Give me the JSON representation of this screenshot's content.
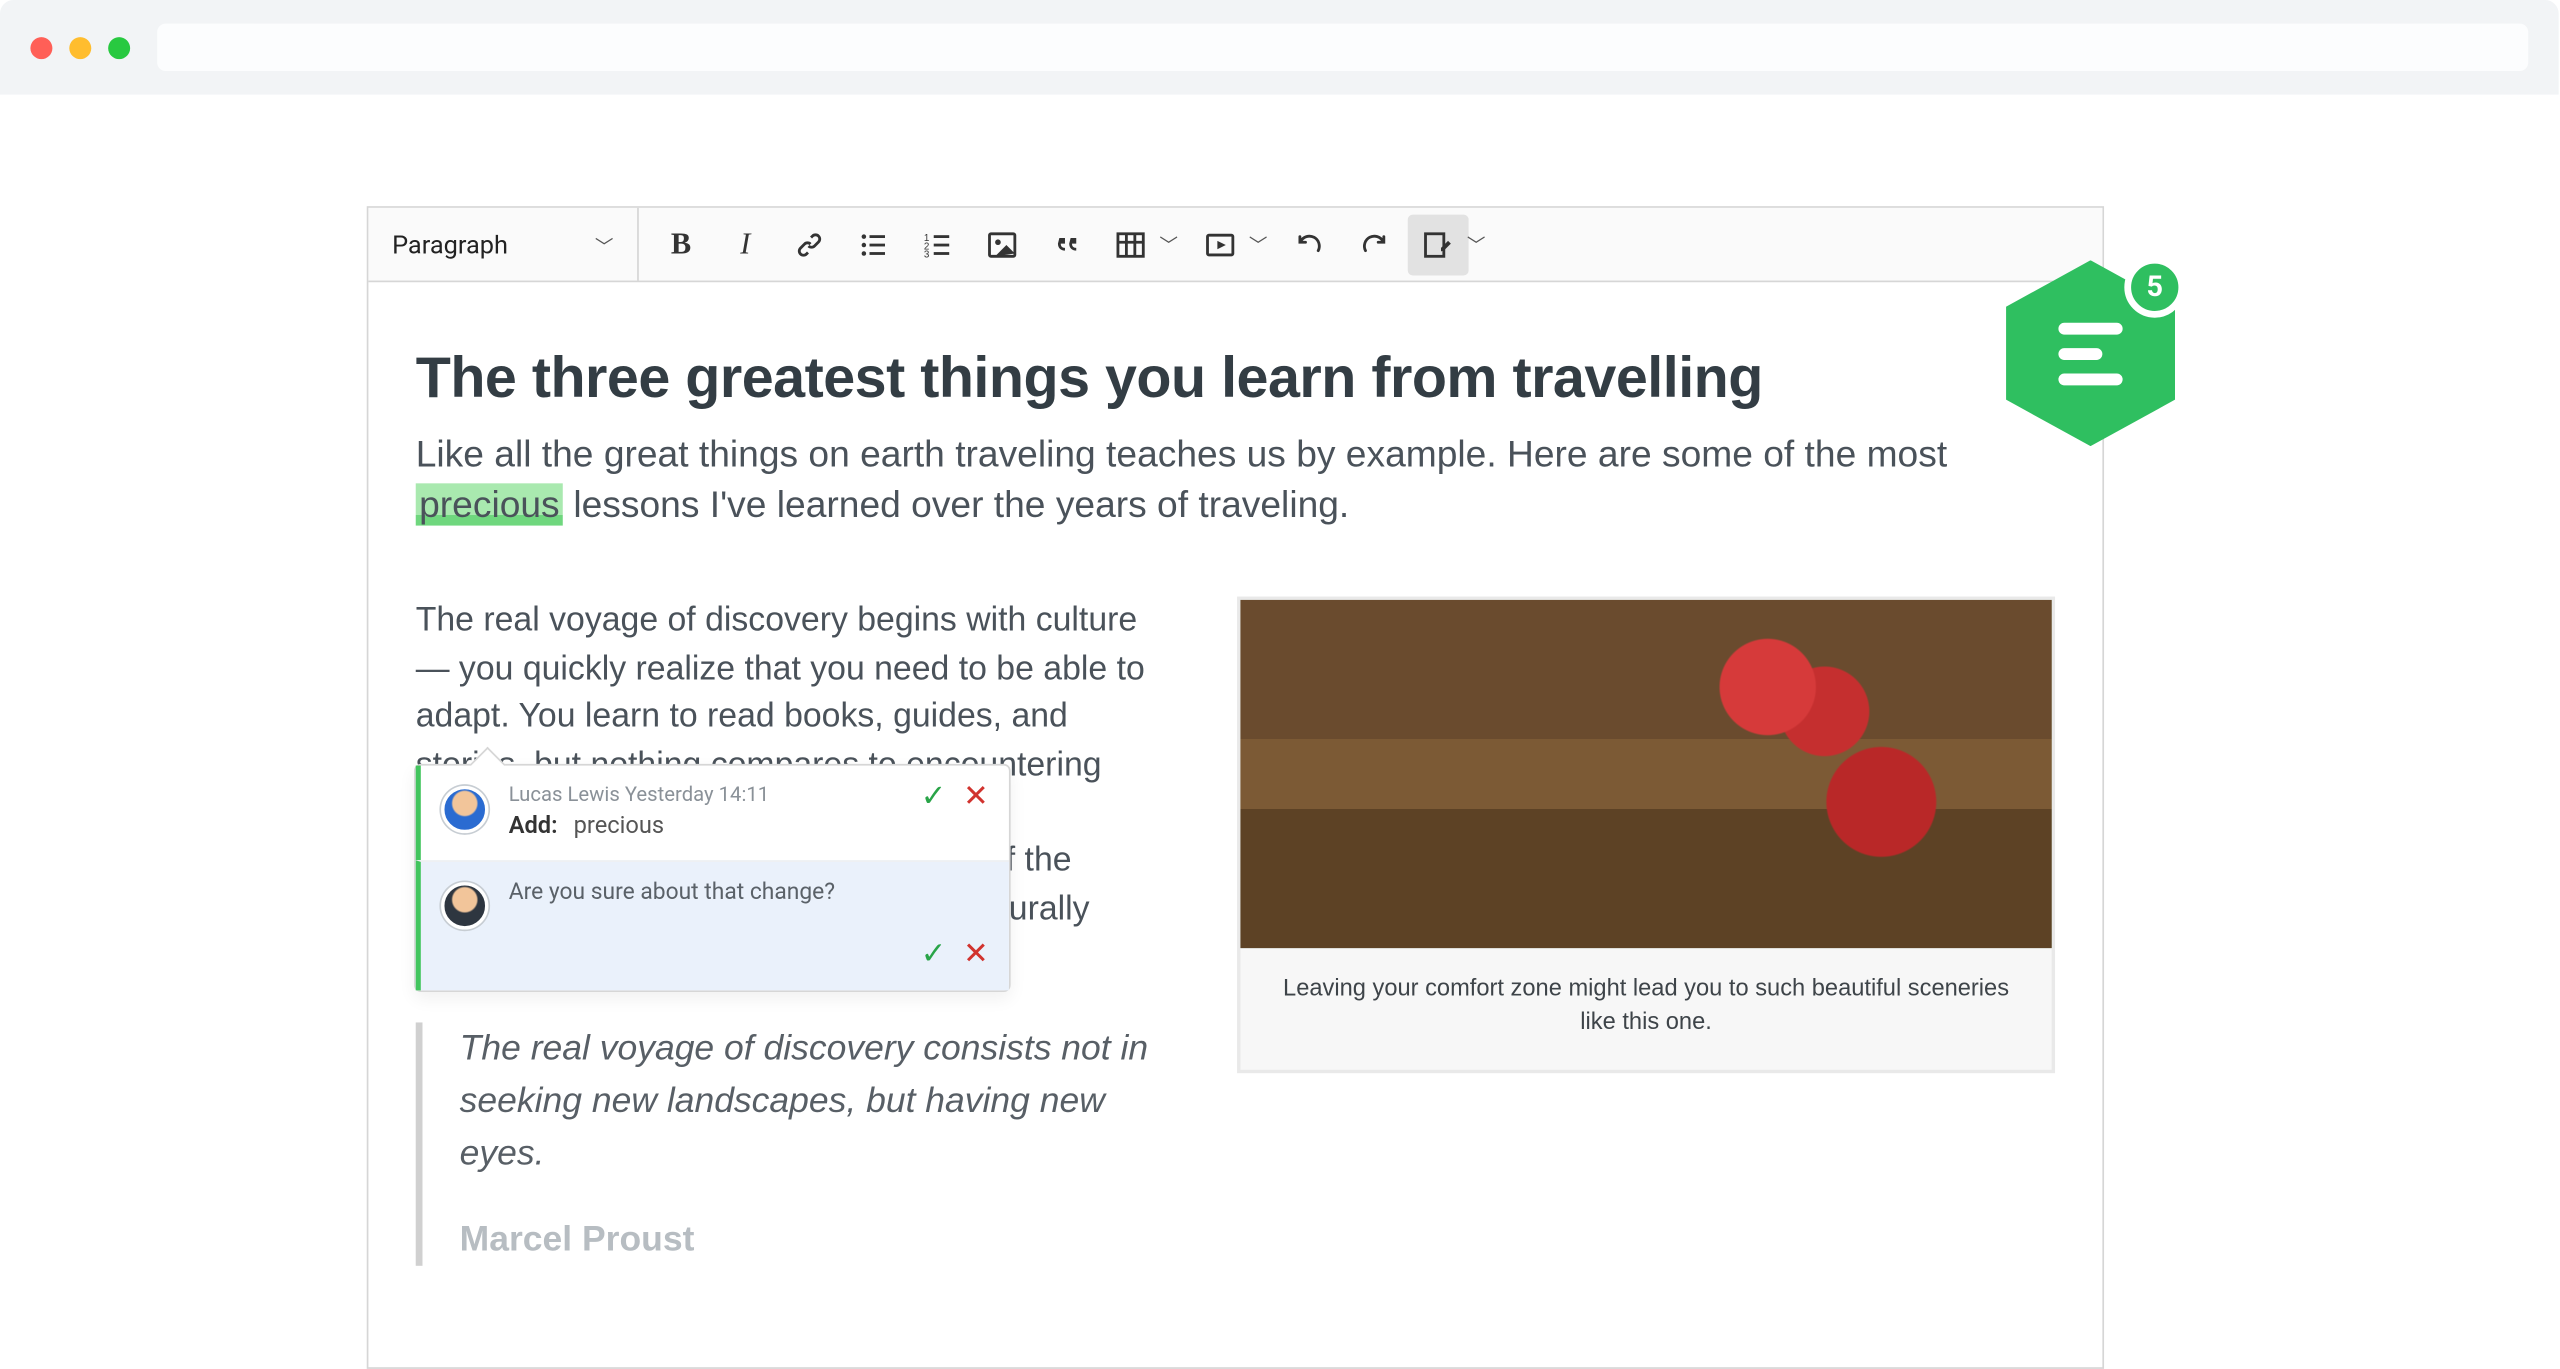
{
  "browser": {
    "address": ""
  },
  "toolbar": {
    "heading": "Paragraph",
    "buttons": {
      "bold": "B",
      "italic": "I",
      "link": "link",
      "ulist": "ulist",
      "olist": "olist",
      "image": "image",
      "quote": "quote",
      "table": "table",
      "media": "media",
      "undo": "undo",
      "redo": "redo",
      "track": "track"
    }
  },
  "badge": {
    "count": "5"
  },
  "doc": {
    "title": "The three greatest things you learn from travelling",
    "lead_before": "Like all the great things on earth traveling teaches us by example. Here are some of the most ",
    "lead_mark": "precious",
    "lead_after": " lessons I've learned over the years of traveling.",
    "body_para": "The real voyage of discovery begins with culture — you quickly realize that you need to be able to adapt. You learn to read books, guides, and stories, but nothing compares to encountering cultural diversity in person. You learn to appreciate each and every single one of the differences while you become more culturally fluid.",
    "quote_text": "The real voyage of discovery consists not in seeking new landscapes, but having new eyes.",
    "quote_author": "Marcel Proust",
    "caption": "Leaving your comfort zone might lead you to such beautiful sceneries like this one."
  },
  "popup": {
    "card1": {
      "author": "Lucas Lewis",
      "time": "Yesterday 14:11",
      "action_label": "Add:",
      "action_value": "precious"
    },
    "card2": {
      "reply": "Are you sure about that change?"
    }
  }
}
